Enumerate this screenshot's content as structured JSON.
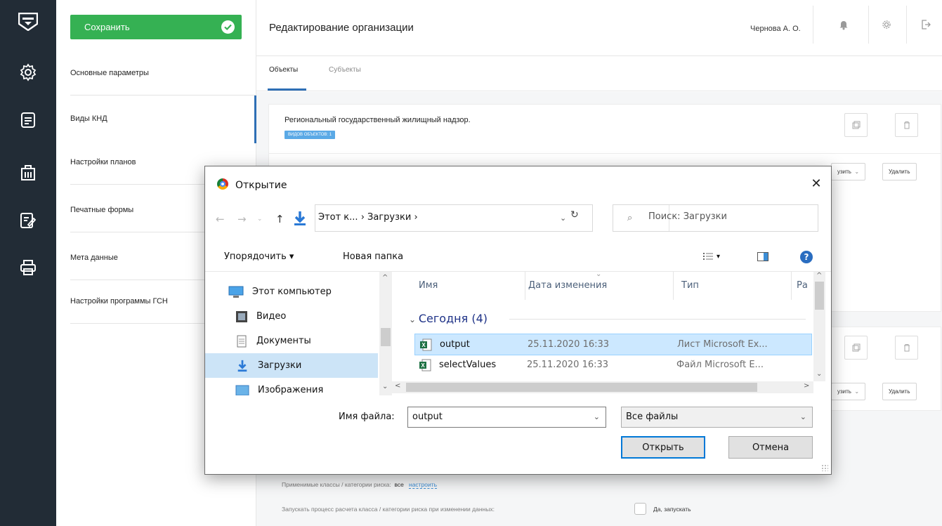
{
  "app": {
    "save_label": "Сохранить",
    "page_title": "Редактирование организации",
    "user_name": "Чернова А. О."
  },
  "sidebar": {
    "items": [
      {
        "label": "Основные параметры"
      },
      {
        "label": "Виды КНД"
      },
      {
        "label": "Настройки планов"
      },
      {
        "label": "Печатные формы"
      },
      {
        "label": "Мета данные"
      },
      {
        "label": "Настройки программы ГСН"
      }
    ]
  },
  "tabs": [
    {
      "label": "Объекты"
    },
    {
      "label": "Субъекты"
    }
  ],
  "card": {
    "title": "Региональный государственный жилищный надзор.",
    "badge": "ВИДОВ ОБЪЕКТОВ: 1",
    "load_label": "узить",
    "delete_label": "Удалить"
  },
  "footer": {
    "risk_label": "Применимые классы / категории риска:",
    "risk_value": "все",
    "risk_link": "настроить",
    "recalc_label": "Запускать процесс расчета класса / категории риска при изменении данных:",
    "recalc_option": "Да, запускать"
  },
  "dialog": {
    "title": "Открытие",
    "close_glyph": "✕",
    "breadcrumb": "Этот к...  ›  Загрузки  ›",
    "search_placeholder": "Поиск: Загрузки",
    "organize_label": "Упорядочить ▾",
    "new_folder_label": "Новая папка",
    "help_glyph": "?",
    "nav_items": [
      {
        "label": "Этот компьютер",
        "icon": "computer-icon"
      },
      {
        "label": "Видео",
        "icon": "video-icon"
      },
      {
        "label": "Документы",
        "icon": "documents-icon"
      },
      {
        "label": "Загрузки",
        "icon": "downloads-icon",
        "selected": true
      },
      {
        "label": "Изображения",
        "icon": "pictures-icon"
      }
    ],
    "columns": [
      "Имя",
      "Дата изменения",
      "Тип",
      "Ра"
    ],
    "group_label": "Сегодня (4)",
    "files": [
      {
        "name": "output",
        "date": "25.11.2020 16:33",
        "type": "Лист Microsoft Ex...",
        "selected": true
      },
      {
        "name": "selectValues",
        "date": "25.11.2020 16:33",
        "type": "Файл Microsoft E..."
      }
    ],
    "filename_label": "Имя файла:",
    "filename_value": "output",
    "filetype_value": "Все файлы",
    "open_label": "Открыть",
    "cancel_label": "Отмена"
  },
  "colors": {
    "rail": "#222c36",
    "save_green": "#35b153",
    "accent_blue": "#2f6fb5",
    "selection": "#cce8ff"
  }
}
